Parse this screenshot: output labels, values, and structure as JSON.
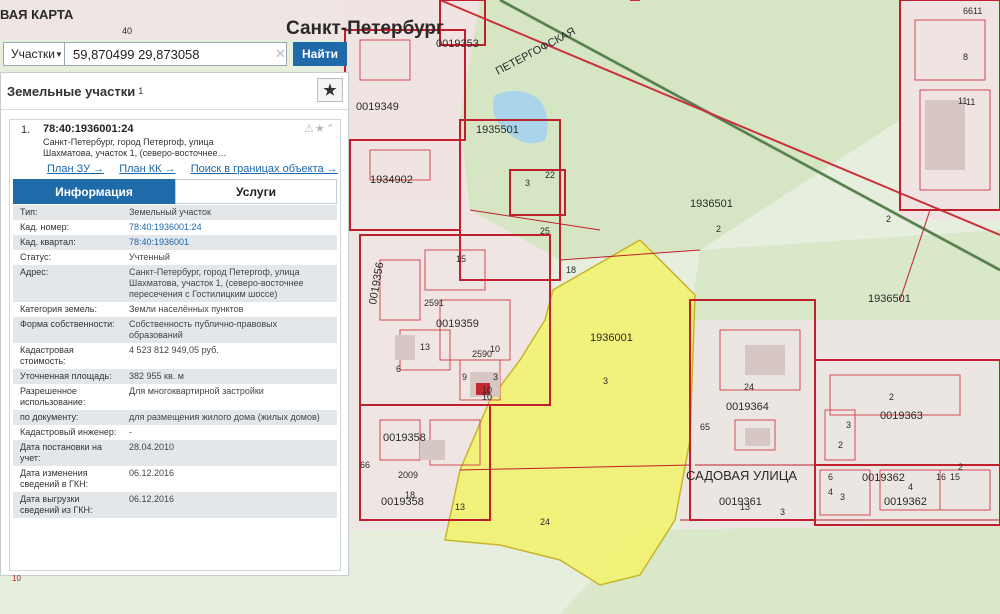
{
  "map": {
    "city_label": "Санкт-Петербург",
    "corner_label": "ВАЯ КАРТА",
    "road_labels": [
      "ПЕТЕРГОФСКАЯ",
      "САДОВАЯ УЛИЦА"
    ],
    "quarter_labels": [
      "0019353",
      "0019349",
      "1935501",
      "1934902",
      "1936501",
      "1936501",
      "0019356",
      "0019359",
      "1936001",
      "0019364",
      "0019363",
      "0019358",
      "0019358",
      "0019361",
      "0019362",
      "0019362"
    ],
    "parcel_numbers": [
      "40",
      "6611",
      "8",
      "11",
      "3",
      "22",
      "25",
      "18",
      "15",
      "2591",
      "13",
      "2590",
      "10",
      "9",
      "3",
      "6",
      "3",
      "24",
      "24",
      "65",
      "66",
      "2009",
      "4",
      "13",
      "3",
      "3",
      "2",
      "2",
      "2",
      "10",
      "16",
      "15",
      "6",
      "4",
      "3",
      "2",
      "13",
      "18",
      "11",
      "10",
      "2"
    ],
    "selected_parcel_color": "#f2f26a",
    "boundary_color": "#c0202c"
  },
  "search": {
    "type_label": "Участки",
    "query": "59,870499 29,873058",
    "clear_icon": "clear-x-icon",
    "find_label": "Найти"
  },
  "panel": {
    "title": "Земельные участки",
    "count": "1",
    "star_icon": "star-icon"
  },
  "result": {
    "index": "1.",
    "cad_number": "78:40:1936001:24",
    "address_short": "Санкт-Петербург, город Петергоф, улица Шахматова, участок 1, (северо-восточнее…",
    "icons": "⚠★⌃",
    "links": [
      "План ЗУ →",
      "План КК →",
      "Поиск в границах объекта →"
    ],
    "tabs": [
      "Информация",
      "Услуги"
    ],
    "attributes": [
      {
        "k": "Тип:",
        "v": "Земельный участок"
      },
      {
        "k": "Кад. номер:",
        "v": "78:40:1936001:24",
        "link": true
      },
      {
        "k": "Кад. квартал:",
        "v": "78:40:1936001",
        "link": true
      },
      {
        "k": "Статус:",
        "v": "Учтенный"
      },
      {
        "k": "Адрес:",
        "v": "Санкт-Петербург, город Петергоф, улица Шахматова, участок 1, (северо-восточнее пересечения с Гостилицким шоссе)"
      },
      {
        "k": "Категория земель:",
        "v": "Земли населённых пунктов"
      },
      {
        "k": "Форма собственности:",
        "v": "Собственность публично-правовых образований"
      },
      {
        "k": "Кадастровая стоимость:",
        "v": "4 523 812 949,05 руб."
      },
      {
        "k": "Уточненная площадь:",
        "v": "382 955 кв. м"
      },
      {
        "k": "Разрешенное использование:",
        "v": "Для многоквартирной застройки"
      },
      {
        "k": "по документу:",
        "v": "для размещения жилого дома (жилых домов)"
      },
      {
        "k": "Кадастровый инженер:",
        "v": "-"
      },
      {
        "k": "Дата постановки на учет:",
        "v": "28.04.2010"
      },
      {
        "k": "Дата изменения сведений в ГКН:",
        "v": "06.12.2016"
      },
      {
        "k": "Дата выгрузки сведений из ГКН:",
        "v": "06.12.2016"
      }
    ]
  },
  "footer_label": "10"
}
